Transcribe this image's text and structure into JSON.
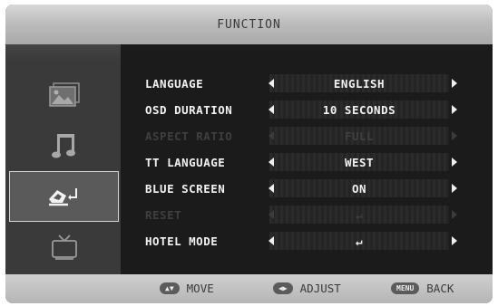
{
  "header": {
    "title": "FUNCTION"
  },
  "sidebar": {
    "items": [
      {
        "icon": "picture-icon",
        "active": false
      },
      {
        "icon": "music-note-icon",
        "active": false
      },
      {
        "icon": "function-pen-icon",
        "active": true
      },
      {
        "icon": "tv-icon",
        "active": false
      }
    ]
  },
  "menu": {
    "rows": [
      {
        "label": "LANGUAGE",
        "value": "ENGLISH",
        "enabled": true
      },
      {
        "label": "OSD DURATION",
        "value": "10 SECONDS",
        "enabled": true
      },
      {
        "label": "ASPECT RATIO",
        "value": "FULL",
        "enabled": false
      },
      {
        "label": "TT LANGUAGE",
        "value": "WEST",
        "enabled": true
      },
      {
        "label": "BLUE SCREEN",
        "value": "ON",
        "enabled": true
      },
      {
        "label": "RESET",
        "value": "↵",
        "enabled": false
      },
      {
        "label": "HOTEL MODE",
        "value": "↵",
        "enabled": true
      }
    ]
  },
  "footer": {
    "move": {
      "key": "▲▼",
      "label": "MOVE"
    },
    "adjust": {
      "key": "◀▶",
      "label": "ADJUST"
    },
    "back": {
      "key": "MENU",
      "label": "BACK"
    }
  }
}
